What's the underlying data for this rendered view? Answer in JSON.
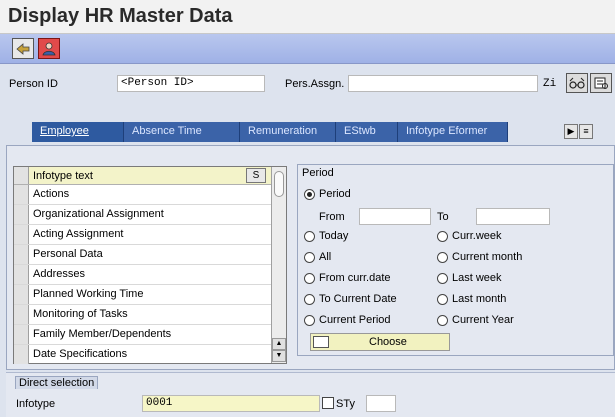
{
  "window": {
    "title": "Display HR Master Data"
  },
  "toolbar": {
    "buttons": [
      "back-icon",
      "person-icon"
    ]
  },
  "header": {
    "person_id_label": "Person ID",
    "person_id_value": "<Person ID>",
    "pers_assign_label": "Pers.Assgn.",
    "right_text": "Zi"
  },
  "tabs": [
    "Employee",
    "Absence Time",
    "Remuneration",
    "EStwb",
    "Infotype Eformer"
  ],
  "infotype_list": {
    "header": "Infotype text",
    "header_button": "S",
    "items": [
      "Actions",
      "Organizational Assignment",
      "Acting Assignment",
      "Personal Data",
      "Addresses",
      "Planned Working Time",
      "Monitoring of Tasks",
      "Family Member/Dependents",
      "Date Specifications"
    ]
  },
  "period": {
    "title": "Period",
    "period_option": "Period",
    "from_label": "From",
    "to_label": "To",
    "from_value": "",
    "to_value": "",
    "options_left": [
      "Today",
      "All",
      "From curr.date",
      "To Current Date",
      "Current Period"
    ],
    "options_right": [
      "Curr.week",
      "Current month",
      "Last week",
      "Last month",
      "Current Year"
    ],
    "choose_label": "Choose"
  },
  "direct_selection": {
    "title": "Direct selection",
    "infotype_label": "Infotype",
    "infotype_value": "0001",
    "sty_label": "STy",
    "sty_value": ""
  }
}
